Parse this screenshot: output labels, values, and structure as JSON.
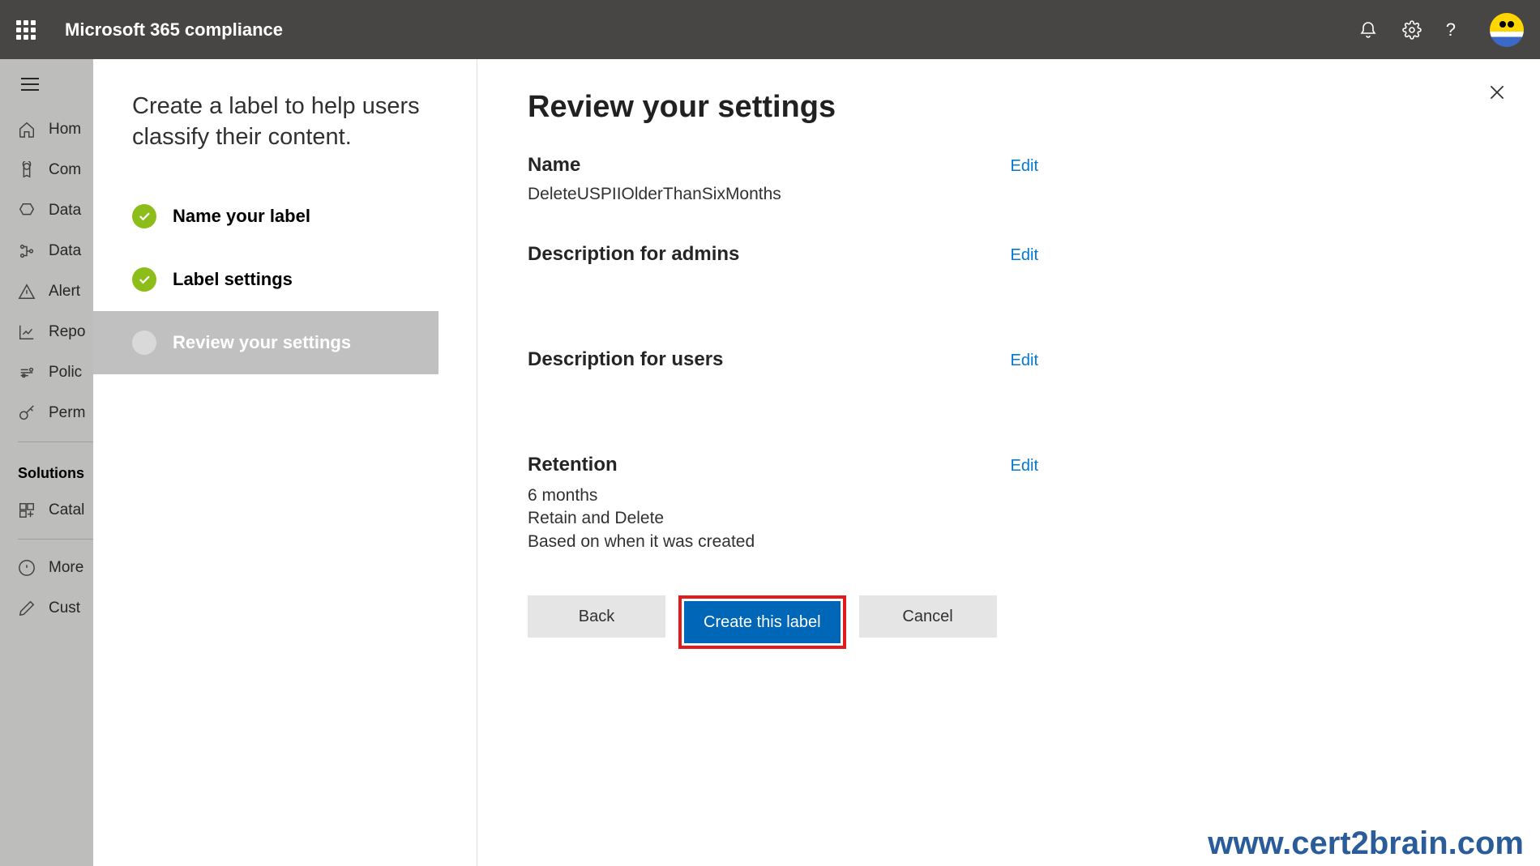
{
  "header": {
    "app_title": "Microsoft 365 compliance"
  },
  "sidebar": {
    "items": [
      {
        "label": "Hom"
      },
      {
        "label": "Com"
      },
      {
        "label": "Data"
      },
      {
        "label": "Data"
      },
      {
        "label": "Alert"
      },
      {
        "label": "Repo"
      },
      {
        "label": "Polic"
      },
      {
        "label": "Perm"
      }
    ],
    "solutions_header": "Solutions",
    "solutions_items": [
      {
        "label": "Catal"
      },
      {
        "label": "More"
      },
      {
        "label": "Cust"
      }
    ]
  },
  "wizard": {
    "panel_title": "Create a label to help users classify their content.",
    "steps": [
      {
        "label": "Name your label",
        "state": "done"
      },
      {
        "label": "Label settings",
        "state": "done"
      },
      {
        "label": "Review your settings",
        "state": "current"
      }
    ]
  },
  "content": {
    "title": "Review your settings",
    "edit_label": "Edit",
    "name_heading": "Name",
    "name_value": "DeleteUSPIIOlderThanSixMonths",
    "admin_desc_heading": "Description for admins",
    "user_desc_heading": "Description for users",
    "retention_heading": "Retention",
    "retention_line1": "6 months",
    "retention_line2": "Retain and Delete",
    "retention_line3": "Based on when it was created",
    "buttons": {
      "back": "Back",
      "create": "Create this label",
      "cancel": "Cancel"
    }
  },
  "watermark": "www.cert2brain.com"
}
